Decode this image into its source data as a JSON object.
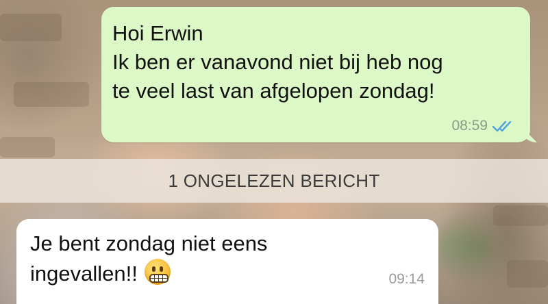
{
  "outgoing_message": {
    "text": "Hoi Erwin\nIk ben er vanavond niet bij heb nog\nte veel last van afgelopen zondag!",
    "time": "08:59",
    "status_icon": "double-check-read-icon",
    "bubble_color": "#dcf8c6",
    "tick_color": "#4fa3e0"
  },
  "unread_divider": {
    "label": "1 ONGELEZEN BERICHT"
  },
  "incoming_message": {
    "text": "Je bent zondag niet eens\ningevallen!!",
    "emoji": "grimacing-face-emoji",
    "time": "09:14",
    "bubble_color": "#ffffff"
  }
}
